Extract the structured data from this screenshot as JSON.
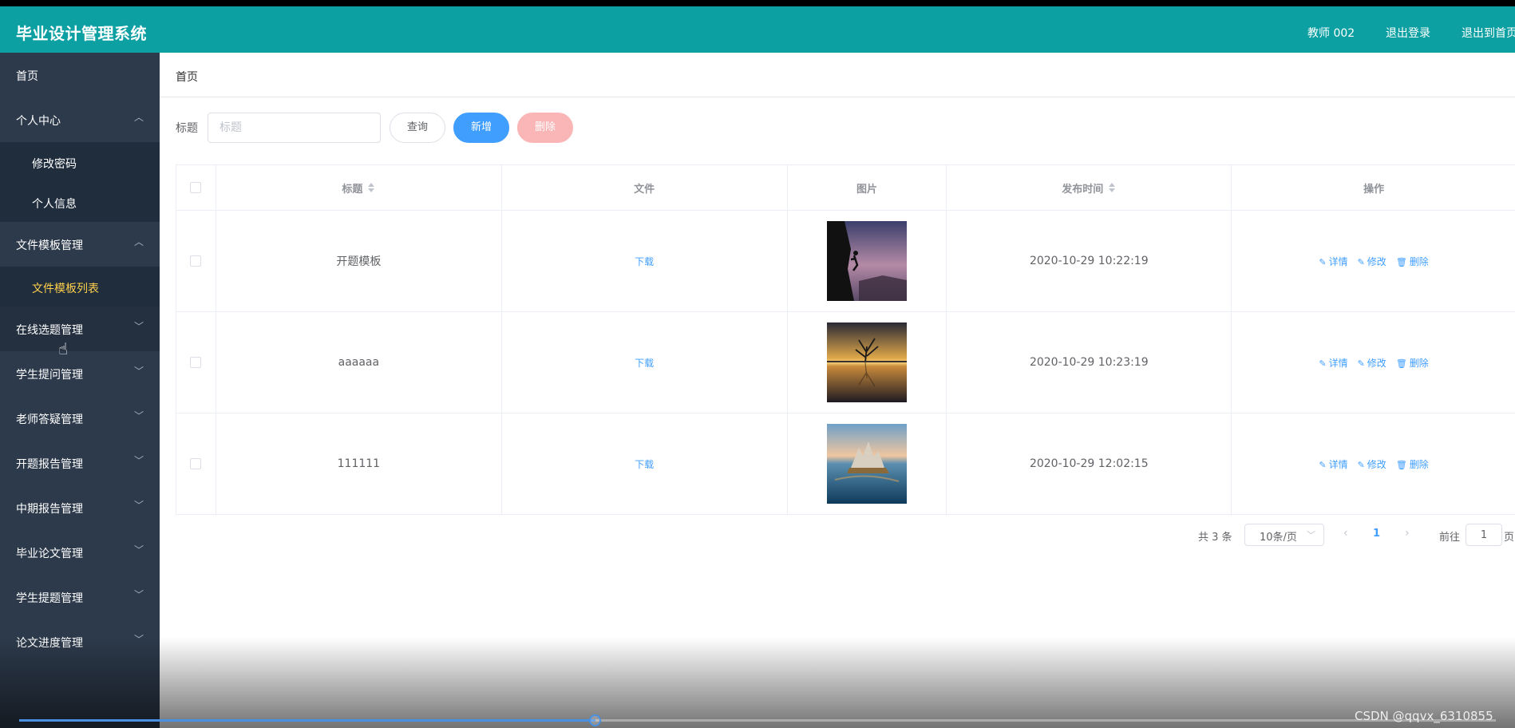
{
  "header": {
    "title": "毕业设计管理系统",
    "user": "教师 002",
    "logout": "退出登录",
    "exit_home": "退出到首页"
  },
  "sidebar": {
    "items": [
      {
        "label": "首页"
      },
      {
        "label": "个人中心",
        "chevron": "︿"
      },
      {
        "label": "修改密码"
      },
      {
        "label": "个人信息"
      },
      {
        "label": "文件模板管理",
        "chevron": "︿"
      },
      {
        "label": "文件模板列表"
      },
      {
        "label": "在线选题管理",
        "chevron": "﹀"
      },
      {
        "label": "学生提问管理",
        "chevron": "﹀"
      },
      {
        "label": "老师答疑管理",
        "chevron": "﹀"
      },
      {
        "label": "开题报告管理",
        "chevron": "﹀"
      },
      {
        "label": "中期报告管理",
        "chevron": "﹀"
      },
      {
        "label": "毕业论文管理",
        "chevron": "﹀"
      },
      {
        "label": "学生提题管理",
        "chevron": "﹀"
      },
      {
        "label": "论文进度管理",
        "chevron": "﹀"
      }
    ]
  },
  "breadcrumb": {
    "current": "首页"
  },
  "search": {
    "label": "标题",
    "placeholder": "标题",
    "query_button": "查询",
    "add_button": "新增",
    "delete_button": "删除"
  },
  "table": {
    "columns": {
      "title": "标题",
      "file": "文件",
      "image": "图片",
      "published": "发布时间",
      "actions": "操作"
    },
    "rows": [
      {
        "title": "开题模板",
        "file": "下载",
        "published": "2020-10-29 10:22:19",
        "image_desc": "climber"
      },
      {
        "title": "aaaaaa",
        "file": "下载",
        "published": "2020-10-29 10:23:19",
        "image_desc": "tree"
      },
      {
        "title": "111111",
        "file": "下载",
        "published": "2020-10-29 12:02:15",
        "image_desc": "castle"
      }
    ],
    "action_labels": {
      "detail": "详情",
      "edit": "修改",
      "delete": "删除"
    }
  },
  "pagination": {
    "total": "共 3 条",
    "page_size": "10条/页",
    "current_page": "1",
    "goto_label": "前往",
    "goto_value": "1",
    "page_unit": "页"
  },
  "video": {
    "watermark": "CSDN @qqvx_6310855",
    "progress": 0.39
  },
  "colors": {
    "header": "#0ca0a3",
    "sidebar": "#2d3a4b",
    "primary": "#409eff",
    "danger_light": "#fab6b6",
    "active_menu": "#ffd04b"
  }
}
